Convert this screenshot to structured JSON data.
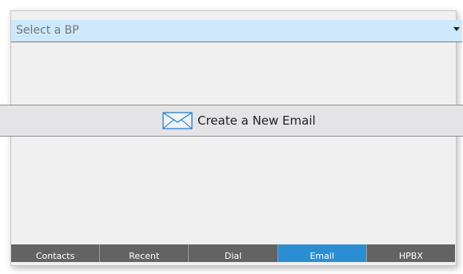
{
  "bp_select": {
    "placeholder": "Select a BP"
  },
  "create_email": {
    "label": "Create a New Email",
    "icon": "envelope-icon"
  },
  "tabs": [
    {
      "label": "Contacts",
      "active": false
    },
    {
      "label": "Recent",
      "active": false
    },
    {
      "label": "Dial",
      "active": false
    },
    {
      "label": "Email",
      "active": true
    },
    {
      "label": "HPBX",
      "active": false
    }
  ],
  "colors": {
    "select_background": "#cde9fb",
    "tab_background": "#636363",
    "tab_active": "#2b8ed3",
    "panel_background": "#f0f0f0"
  }
}
